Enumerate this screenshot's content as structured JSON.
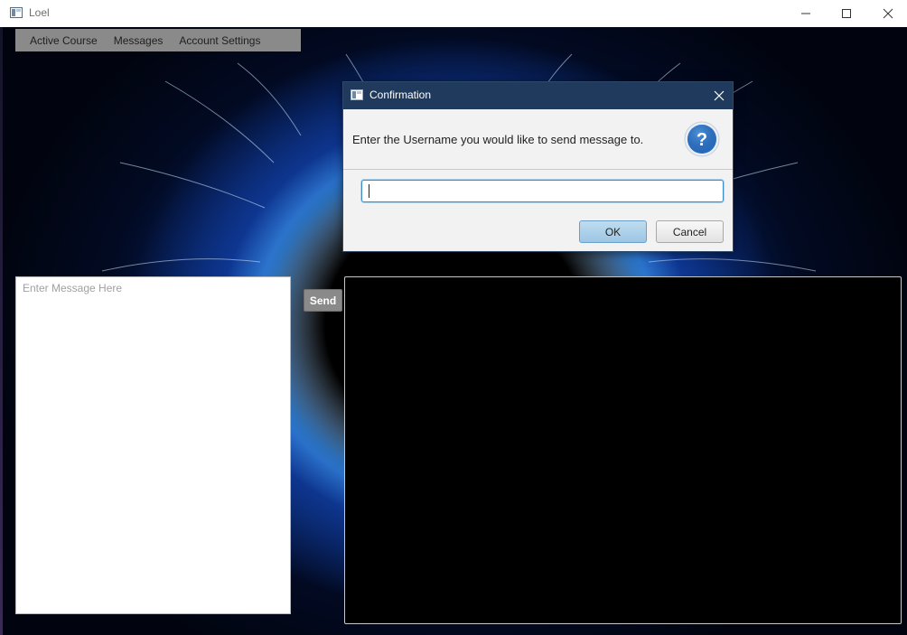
{
  "window": {
    "title": "Loel"
  },
  "menubar": {
    "items": [
      "Active Course",
      "Messages",
      "Account Settings"
    ]
  },
  "message_input": {
    "placeholder": "Enter Message Here",
    "value": ""
  },
  "send_button": {
    "label": "Send"
  },
  "dialog": {
    "title": "Confirmation",
    "header_text": "Enter the Username you would like to send message to.",
    "icon": "question-icon",
    "input_value": "",
    "ok_label": "OK",
    "cancel_label": "Cancel"
  },
  "colors": {
    "dialog_titlebar": "#1f3a5c",
    "menubar_bg": "#8a8a8a",
    "ok_button": "#a9cfea",
    "question_icon": "#2a6fc0",
    "input_focus": "#3c8ec8"
  }
}
